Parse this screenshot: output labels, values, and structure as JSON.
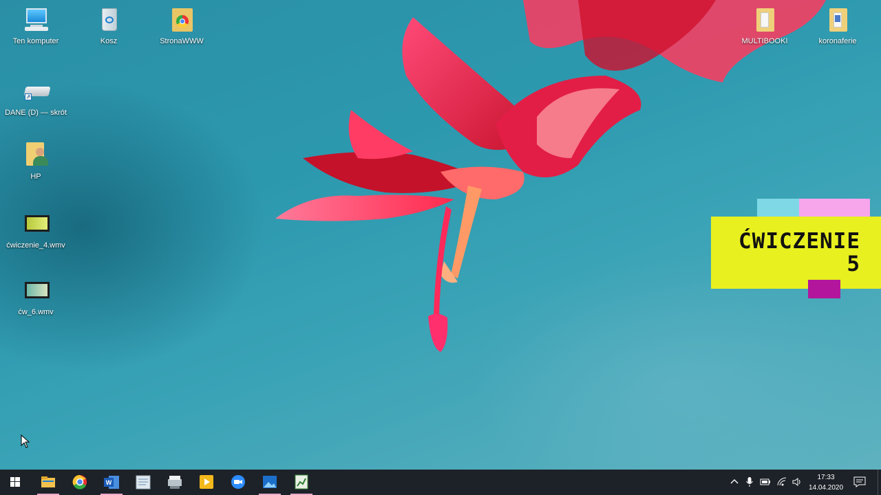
{
  "desktop_icons": [
    {
      "name": "computer-icon",
      "label": "Ten komputer"
    },
    {
      "name": "recycle-bin-icon",
      "label": "Kosz"
    },
    {
      "name": "chrome-folder-icon",
      "label": "StronaWWW"
    },
    {
      "name": "drive-shortcut-icon",
      "label": "DANE (D) — skrót"
    },
    {
      "name": "user-folder-icon",
      "label": "HP"
    },
    {
      "name": "video-file-icon",
      "label": "ćwiczenie_4.wmv"
    },
    {
      "name": "video-file-icon",
      "label": "ćw_6.wmv"
    },
    {
      "name": "folder-icon",
      "label": "MULTIBOOKI"
    },
    {
      "name": "folder-icon",
      "label": "koronaferie"
    }
  ],
  "overlay": {
    "line1": "ĆWICZENIE",
    "line2": "5",
    "colors": {
      "yellow": "#e8f01f",
      "cyan": "#7fd8e6",
      "pink": "#f7a6ec",
      "magenta": "#b3169c"
    }
  },
  "taskbar": {
    "apps": [
      "start-icon",
      "file-explorer-icon",
      "chrome-icon",
      "word-icon",
      "notepad-icon",
      "scanner-icon",
      "media-player-icon",
      "zoom-icon",
      "photos-icon",
      "spreadsheet-icon"
    ],
    "tray": [
      "chevron-up-icon",
      "microphone-icon",
      "battery-icon",
      "wifi-icon",
      "volume-icon",
      "notifications-icon"
    ],
    "time": "17:33",
    "date": "14.04.2020"
  }
}
